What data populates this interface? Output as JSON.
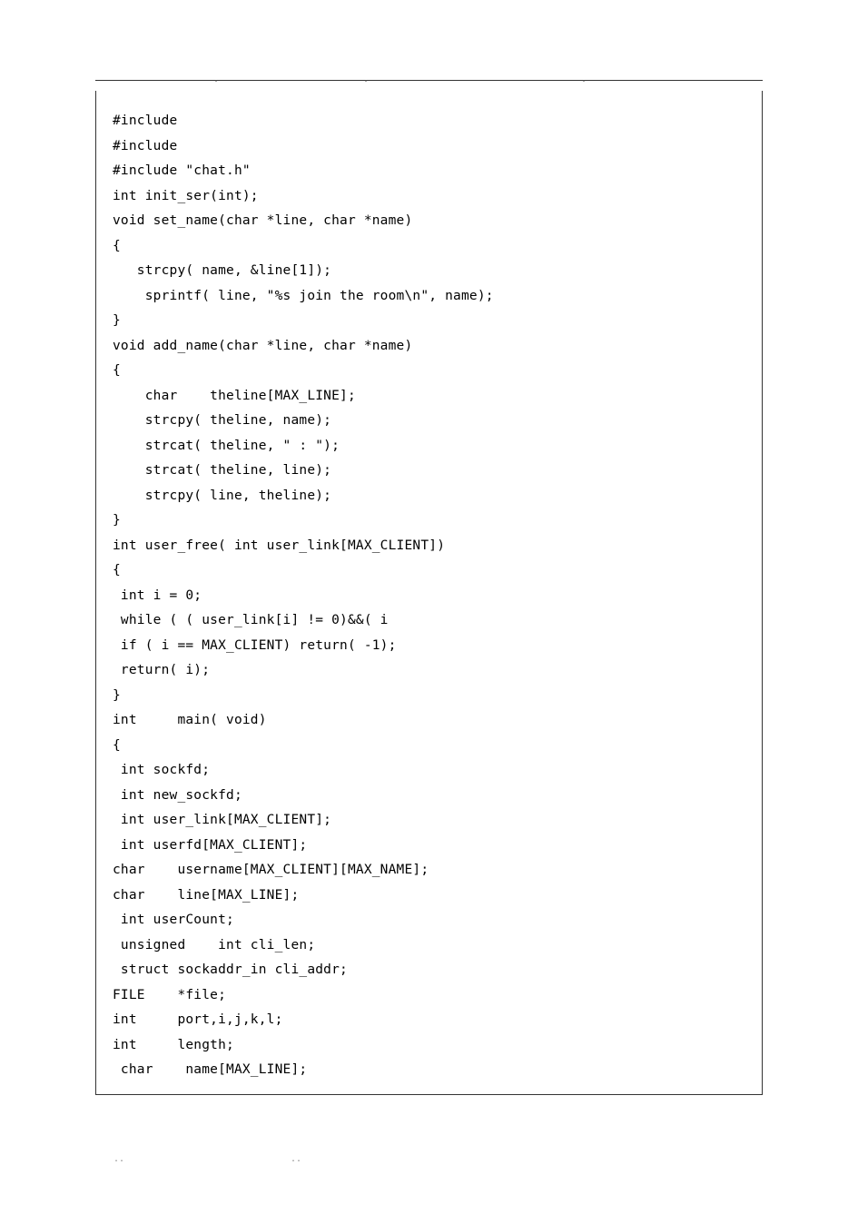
{
  "code": {
    "lines": [
      "#include",
      "#include",
      "#include \"chat.h\"",
      "int init_ser(int);",
      "void set_name(char *line, char *name)",
      "{",
      "   strcpy( name, &line[1]);",
      "    sprintf( line, \"%s join the room\\n\", name);",
      "}",
      "void add_name(char *line, char *name)",
      "{",
      "    char    theline[MAX_LINE];",
      "    strcpy( theline, name);",
      "    strcat( theline, \" : \");",
      "    strcat( theline, line);",
      "    strcpy( line, theline);",
      "}",
      "int user_free( int user_link[MAX_CLIENT])",
      "{",
      " int i = 0;",
      " while ( ( user_link[i] != 0)&&( i",
      " if ( i == MAX_CLIENT) return( -1);",
      " return( i);",
      "}",
      "int     main( void)",
      "{",
      " int sockfd;",
      " int new_sockfd;",
      " int user_link[MAX_CLIENT];",
      " int userfd[MAX_CLIENT];",
      "char    username[MAX_CLIENT][MAX_NAME];",
      "char    line[MAX_LINE];",
      " int userCount;",
      " unsigned    int cli_len;",
      " struct sockaddr_in cli_addr;",
      "FILE    *file;",
      "int     port,i,j,k,l;",
      "int     length;",
      " char    name[MAX_LINE];"
    ]
  }
}
